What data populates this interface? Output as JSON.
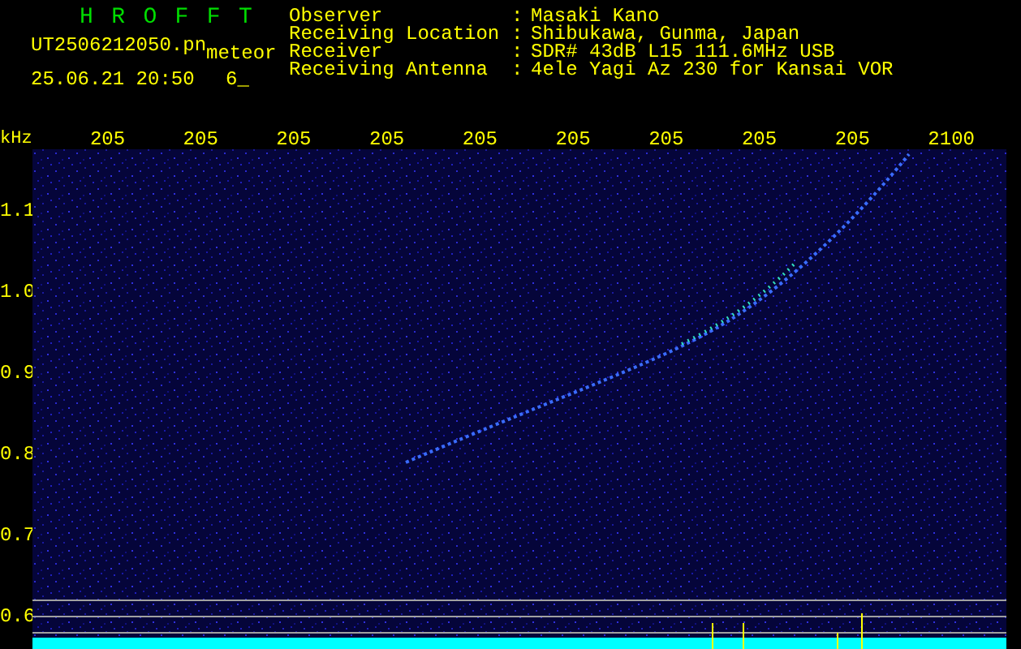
{
  "header": {
    "title": "H R O F F T",
    "filename": "UT2506212050.pn",
    "mode": "meteor",
    "datetime": "25.06.21 20:50",
    "counter": "6_"
  },
  "info": [
    {
      "label": "Observer",
      "colon": ":",
      "value": "Masaki Kano"
    },
    {
      "label": "Receiving Location",
      "colon": ":",
      "value": "Shibukawa, Gunma, Japan"
    },
    {
      "label": "Receiver",
      "colon": ":",
      "value": "SDR# 43dB L15 111.6MHz USB"
    },
    {
      "label": "Receiving Antenna",
      "colon": ":",
      "value": "4ele Yagi Az 230 for Kansai VOR"
    }
  ],
  "x_axis": {
    "unit": "kHz",
    "labels": [
      "205",
      "205",
      "205",
      "205",
      "205",
      "205",
      "205",
      "205",
      "205",
      "2100"
    ]
  },
  "y_axis": {
    "labels": [
      "1.1",
      "1.0",
      "0.9",
      "0.8",
      "0.7",
      "0.6"
    ]
  }
}
